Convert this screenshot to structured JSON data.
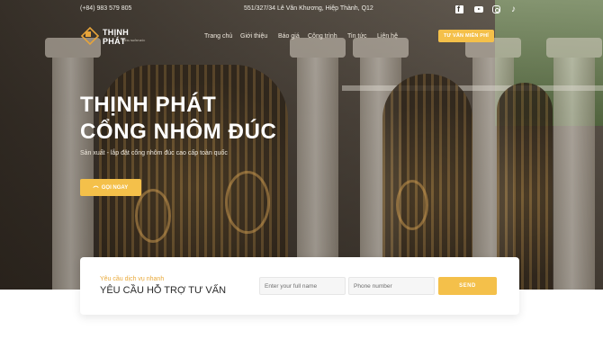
{
  "topbar": {
    "phone": "(+84) 983 579 805",
    "address": "551/327/34 Lê Văn Khương, Hiệp Thành, Q12"
  },
  "social_icons": [
    "facebook-icon",
    "youtube-icon",
    "instagram-icon",
    "tiktok-icon"
  ],
  "logo": {
    "name": "THỊNH PHÁT",
    "tagline": "CỔNG NHÔM ĐÚC"
  },
  "nav": {
    "items": [
      "Trang chủ",
      "Giới thiệu",
      "Báo giá",
      "Công trình",
      "Tin tức",
      "Liên hệ"
    ],
    "cta": "TƯ VẤN MIỄN PHÍ"
  },
  "hero": {
    "title_line1": "THỊNH PHÁT",
    "title_line2": "CỔNG NHÔM ĐÚC",
    "subtitle": "Sản xuất - lắp đặt cổng nhôm đúc cao cấp toàn quốc",
    "call_button": "GỌI NGAY"
  },
  "form": {
    "kicker": "Yêu cầu dịch vụ nhanh",
    "title": "YÊU CẦU HỖ TRỢ TƯ VẤN",
    "name_placeholder": "Enter your full name",
    "phone_placeholder": "Phone number",
    "send_label": "SEND"
  },
  "colors": {
    "accent": "#f4c04a",
    "kicker": "#e9a93a",
    "title": "#2b2b2b"
  }
}
